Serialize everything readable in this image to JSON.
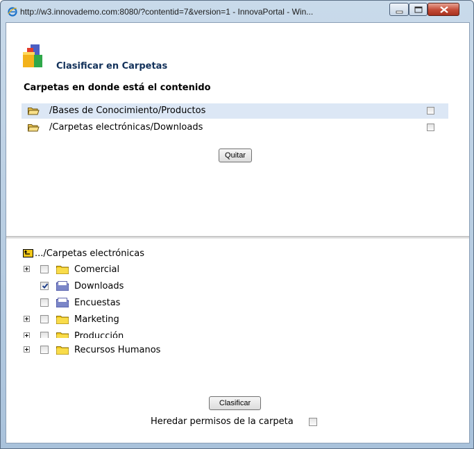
{
  "window": {
    "title": "http://w3.innovademo.com:8080/?contentid=7&version=1 - InnovaPortal - Win..."
  },
  "header": {
    "title": "Clasificar en Carpetas",
    "section_title": "Carpetas en donde está el contenido"
  },
  "assigned_folders": [
    {
      "path": "/Bases de Conocimiento/Productos",
      "checked": false,
      "selected": true
    },
    {
      "path": "/Carpetas electrónicas/Downloads",
      "checked": false,
      "selected": false
    }
  ],
  "buttons": {
    "remove_label": "Quitar",
    "classify_label": "Clasificar"
  },
  "browser": {
    "parent_path": ".../Carpetas electrónicas",
    "items": [
      {
        "label": "Comercial",
        "expandable": true,
        "checked": false,
        "folder_icon": "folder-icon"
      },
      {
        "label": "Downloads",
        "expandable": false,
        "checked": true,
        "folder_icon": "folder-shared-icon"
      },
      {
        "label": "Encuestas",
        "expandable": false,
        "checked": false,
        "folder_icon": "folder-shared-icon"
      },
      {
        "label": "Marketing",
        "expandable": true,
        "checked": false,
        "folder_icon": "folder-icon"
      },
      {
        "label": "Producción",
        "expandable": true,
        "checked": false,
        "folder_icon": "folder-icon"
      },
      {
        "label": "Recursos Humanos",
        "expandable": true,
        "checked": false,
        "folder_icon": "folder-icon"
      }
    ]
  },
  "inherit": {
    "label": "Heredar permisos de la carpeta",
    "checked": false
  },
  "colors": {
    "selected_row": "#dce7f5",
    "folder_yellow": "#f2c81a",
    "folder_shared_blue": "#7b86c8",
    "title_text": "#12315a"
  }
}
